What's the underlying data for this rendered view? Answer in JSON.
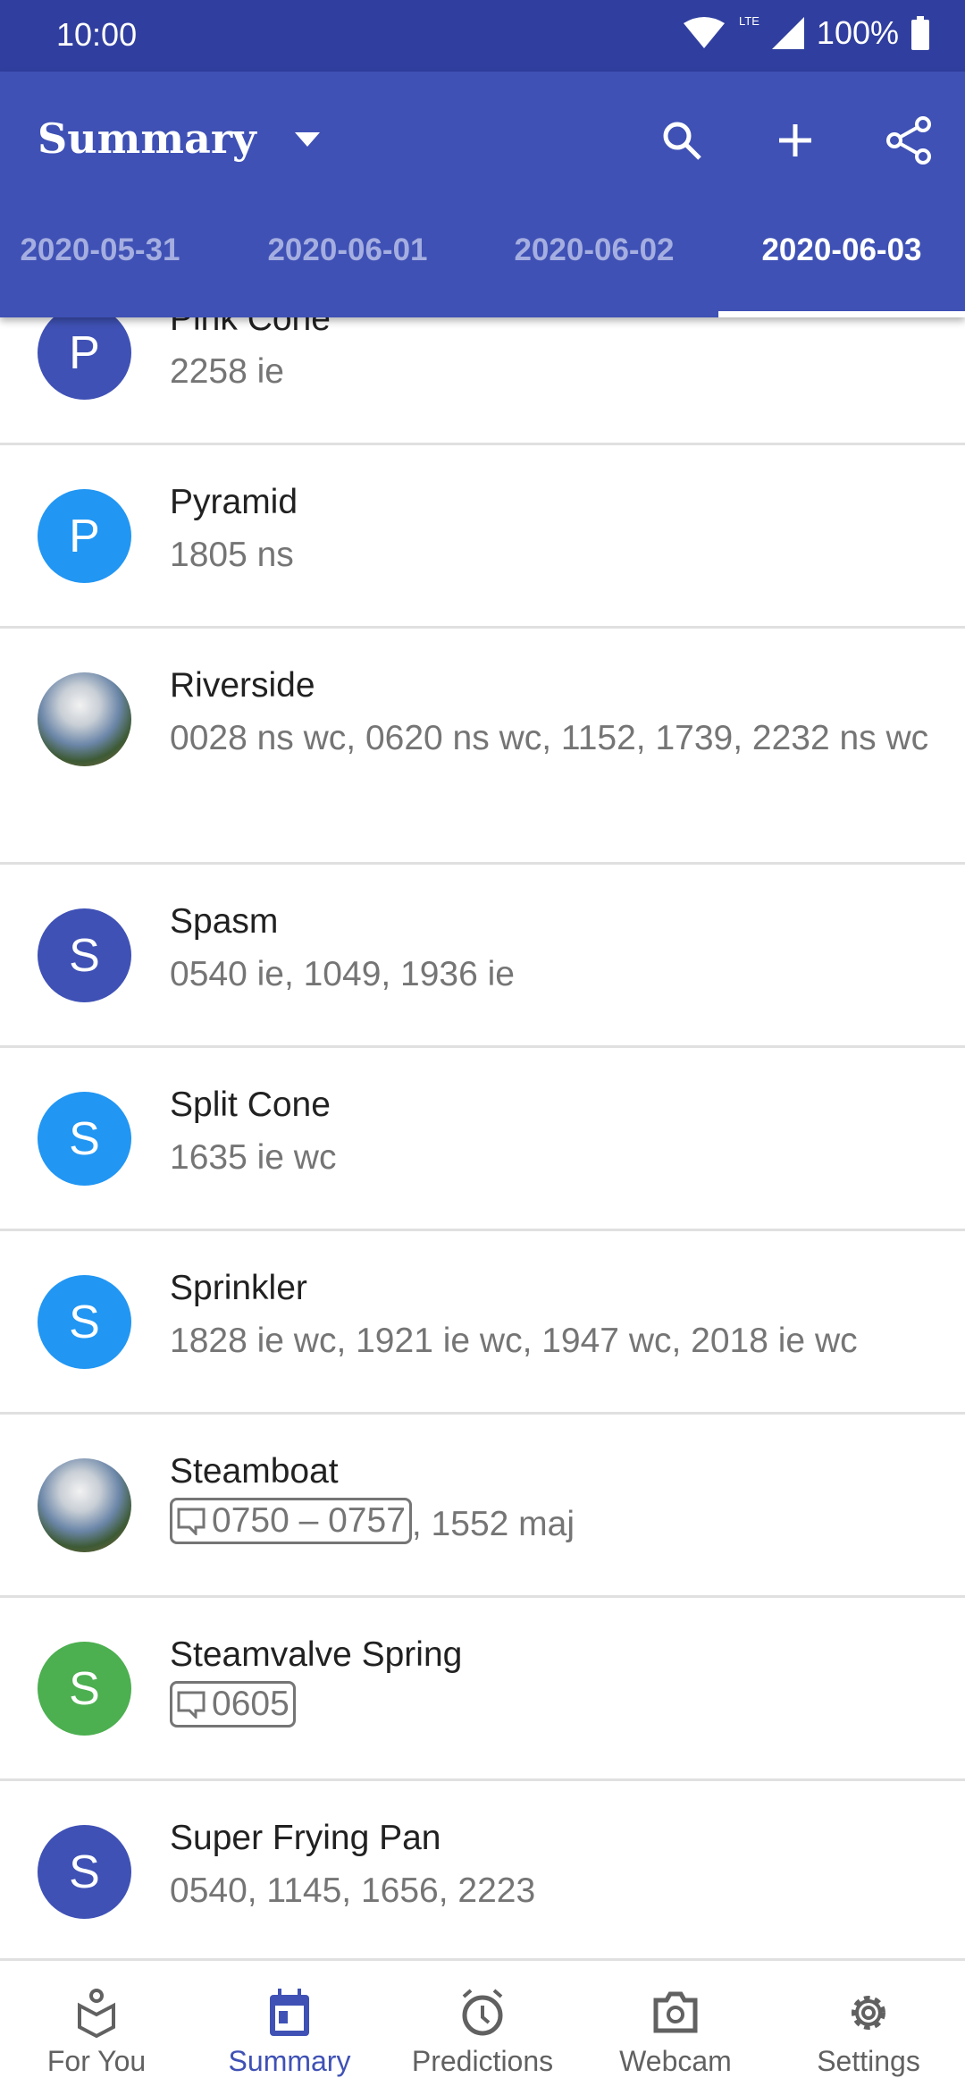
{
  "status_bar": {
    "time": "10:00",
    "network": "LTE",
    "battery": "100%"
  },
  "app_bar": {
    "title": "Summary",
    "icons": [
      "dropdown-icon",
      "search-icon",
      "add-icon",
      "share-icon"
    ]
  },
  "tabs": [
    {
      "label": "2020-05-31"
    },
    {
      "label": "2020-06-01"
    },
    {
      "label": "2020-06-02"
    },
    {
      "label": "2020-06-03",
      "active": true
    }
  ],
  "items": [
    {
      "name": "Pink Cone",
      "letter": "P",
      "color": "#3F51B5",
      "times": "2258 ie"
    },
    {
      "name": "Pyramid",
      "letter": "P",
      "color": "#2196F3",
      "times": "1805 ns"
    },
    {
      "name": "Riverside",
      "photo": true,
      "times": "0028 ns wc, 0620 ns wc, 1152, 1739, 2232 ns wc"
    },
    {
      "name": "Spasm",
      "letter": "S",
      "color": "#3F51B5",
      "times": "0540 ie, 1049, 1936 ie"
    },
    {
      "name": "Split Cone",
      "letter": "S",
      "color": "#2196F3",
      "times": "1635 ie wc"
    },
    {
      "name": "Sprinkler",
      "letter": "S",
      "color": "#2196F3",
      "times": "1828 ie wc, 1921 ie wc, 1947 wc, 2018 ie wc"
    },
    {
      "name": "Steamboat",
      "photo": true,
      "boxed": "0750 – 0757",
      "times": ", 1552 maj"
    },
    {
      "name": "Steamvalve Spring",
      "letter": "S",
      "color": "#4CAF50",
      "boxed": "0605",
      "times": ""
    },
    {
      "name": "Super Frying Pan",
      "letter": "S",
      "color": "#3F51B5",
      "times": "0540, 1145, 1656, 2223"
    }
  ],
  "bottom_nav": [
    {
      "label": "For You",
      "icon": "reader-icon"
    },
    {
      "label": "Summary",
      "icon": "calendar-icon",
      "active": true
    },
    {
      "label": "Predictions",
      "icon": "alarm-icon"
    },
    {
      "label": "Webcam",
      "icon": "camera-icon"
    },
    {
      "label": "Settings",
      "icon": "gear-icon"
    }
  ],
  "colors": {
    "primary": "#3F51B5",
    "primary_dark": "#303F9F",
    "accent_blue": "#2196F3",
    "green": "#4CAF50"
  }
}
